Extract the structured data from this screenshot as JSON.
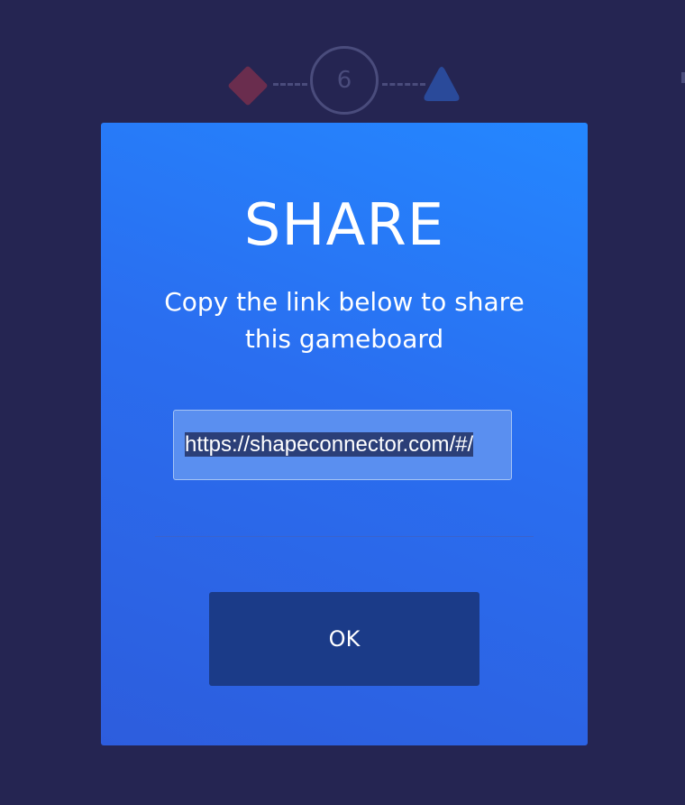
{
  "background": {
    "color": "#252552",
    "board_step_number": "6"
  },
  "modal": {
    "title": "SHARE",
    "subtitle": "Copy the link below to share this gameboard",
    "link_value": "https://shapeconnector.com/#/",
    "ok_label": "OK"
  },
  "colors": {
    "modal_gradient_start": "#2487ff",
    "modal_gradient_end": "#2d5ddd",
    "ok_button": "#1b3b88",
    "diamond": "#6a2d4e",
    "triangle": "#2a4a9a"
  },
  "icons": {
    "diamond": "diamond-shape-icon",
    "triangle": "triangle-shape-icon"
  }
}
